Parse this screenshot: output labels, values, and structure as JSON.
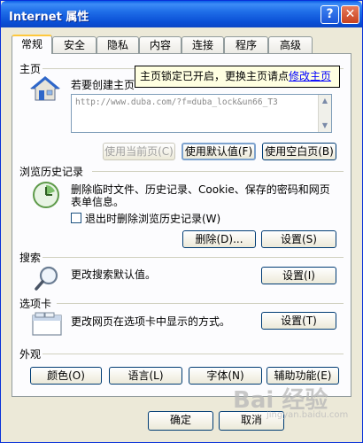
{
  "window": {
    "title": "Internet 属性",
    "help_label": "?",
    "close_label": "✕"
  },
  "tabs": [
    {
      "label": "常规",
      "active": true
    },
    {
      "label": "安全"
    },
    {
      "label": "隐私"
    },
    {
      "label": "内容"
    },
    {
      "label": "连接"
    },
    {
      "label": "程序"
    },
    {
      "label": "高级"
    }
  ],
  "home": {
    "label": "主页",
    "description": "若要创建主页",
    "url": "http://www.duba.com/?f=duba_lock&un66_T3",
    "tooltip_text": "主页锁定已开启，更换主页请点",
    "tooltip_link": "修改主页",
    "use_current": "使用当前页(C)",
    "use_default": "使用默认值(F)",
    "use_blank": "使用空白页(B)"
  },
  "history": {
    "label": "浏览历史记录",
    "description_line1": "删除临时文件、历史记录、Cookie、保存的密码和网页",
    "description_line2": "表单信息。",
    "delete_on_exit": "退出时删除浏览历史记录(W)",
    "delete_button": "删除(D)...",
    "settings_button": "设置(S)"
  },
  "search": {
    "label": "搜索",
    "description": "更改搜索默认值。",
    "settings_button": "设置(I)"
  },
  "tabs_section": {
    "label": "选项卡",
    "description": "更改网页在选项卡中显示的方式。",
    "settings_button": "设置(T)"
  },
  "appearance": {
    "label": "外观",
    "colors": "颜色(O)",
    "languages": "语言(L)",
    "fonts": "字体(N)",
    "accessibility": "辅助功能(E)"
  },
  "footer": {
    "ok": "确定",
    "cancel": "取消"
  },
  "watermark": {
    "brand": "Bai 经验",
    "sub": "jingyan.baidu.com"
  }
}
